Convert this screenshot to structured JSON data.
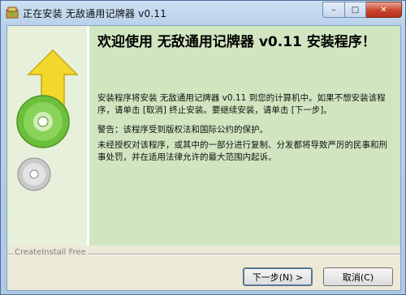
{
  "window": {
    "title": "正在安装 无敌通用记牌器 v0.11"
  },
  "controls": {
    "minimize": "–",
    "maximize": "□",
    "close": "✕"
  },
  "content": {
    "heading": "欢迎使用 无敌通用记牌器 v0.11 安装程序！",
    "paragraphs": [
      "安装程序将安装 无敌通用记牌器 v0.11 到您的计算机中。如果不想安装该程序，请单击 [取消] 终止安装。要继续安装，请单击 [下一步]。",
      "警告：该程序受到版权法和国际公约的保护。",
      "未经授权对该程序，或其中的一部分进行复制、分发都将导致严厉的民事和刑事处罚，并在适用法律允许的最大范围内起诉。"
    ]
  },
  "footer": {
    "brand": "CreateInstall Free"
  },
  "buttons": {
    "next": "下一步(N) >",
    "cancel": "取消(C)"
  },
  "colors": {
    "content_bg": "#d1e6c0",
    "sidepanel_bg": "#e6f0db",
    "arrow": "#f2d82a",
    "disc": "#6bbf3a"
  }
}
